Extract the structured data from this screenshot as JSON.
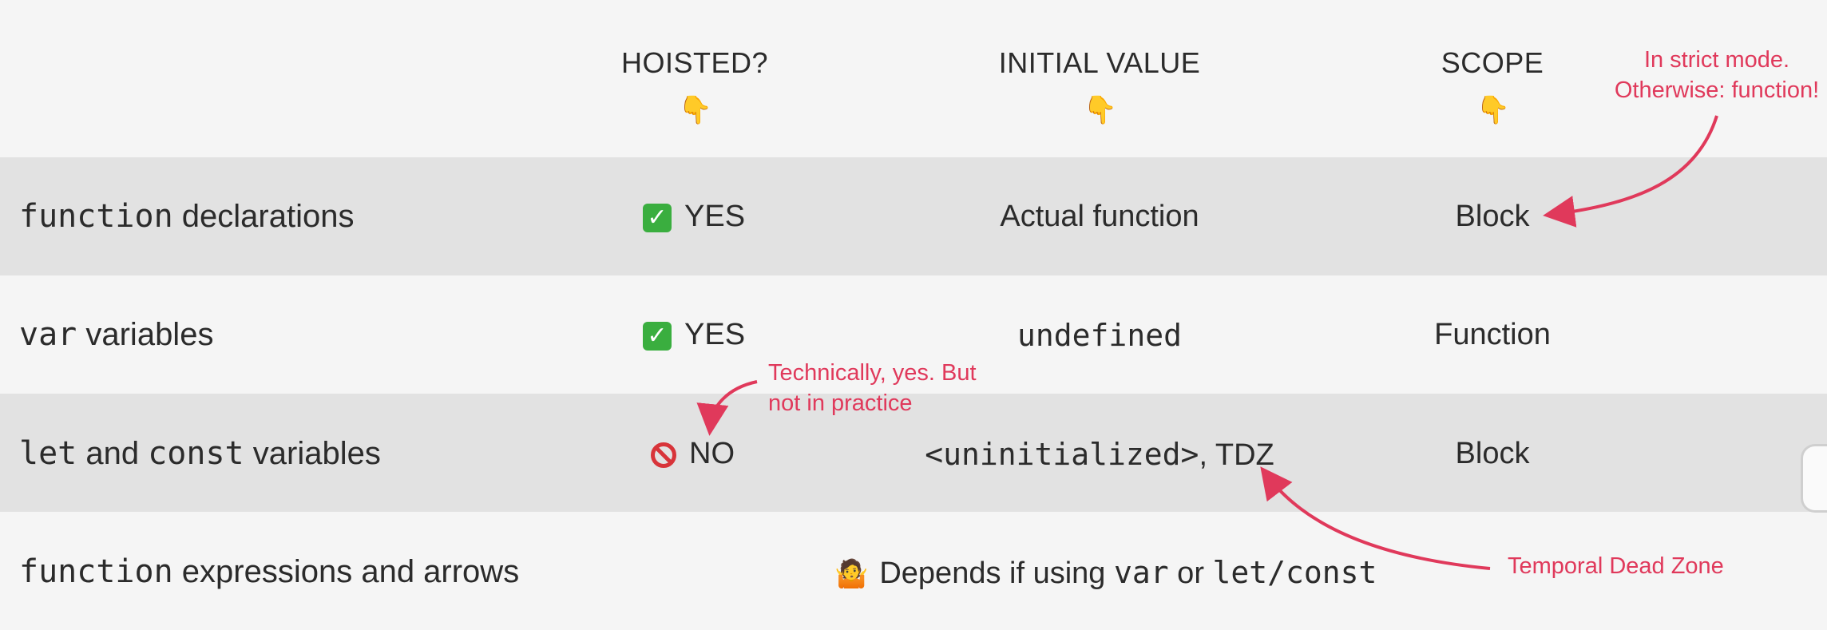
{
  "headers": {
    "hoisted": "HOISTED?",
    "initial_value": "INITIAL VALUE",
    "scope": "SCOPE",
    "pointer_icon": "backhand-index-pointing-down"
  },
  "rows": [
    {
      "label_code": "function",
      "label_text": " declarations",
      "hoisted_icon": "check-mark-button",
      "hoisted": "YES",
      "initial_value": "Actual function",
      "scope": "Block"
    },
    {
      "label_code": "var",
      "label_text": " variables",
      "hoisted_icon": "check-mark-button",
      "hoisted": "YES",
      "initial_value": "undefined",
      "scope": "Function"
    },
    {
      "label_code_1": "let",
      "label_mid": " and ",
      "label_code_2": "const",
      "label_text": " variables",
      "hoisted_icon": "prohibited",
      "hoisted": "NO",
      "initial_value_code": "<uninitialized>",
      "initial_value_text": ", TDZ",
      "scope": "Block"
    },
    {
      "label_code": "function",
      "label_text": " expressions and arrows",
      "span_icon": "person-shrugging",
      "span_text_1": "Depends if using ",
      "span_code_1": "var",
      "span_text_2": " or ",
      "span_code_2": "let/const"
    }
  ],
  "annotations": {
    "strict_mode_line1": "In strict mode.",
    "strict_mode_line2": "Otherwise: function!",
    "technically_line1": "Technically, yes. But",
    "technically_line2": "not in practice",
    "tdz": "Temporal Dead Zone"
  },
  "colors": {
    "accent": "#e0395b",
    "row_alt": "#e2e2e2",
    "background": "#f5f5f5",
    "check_green": "#3aae3f"
  }
}
